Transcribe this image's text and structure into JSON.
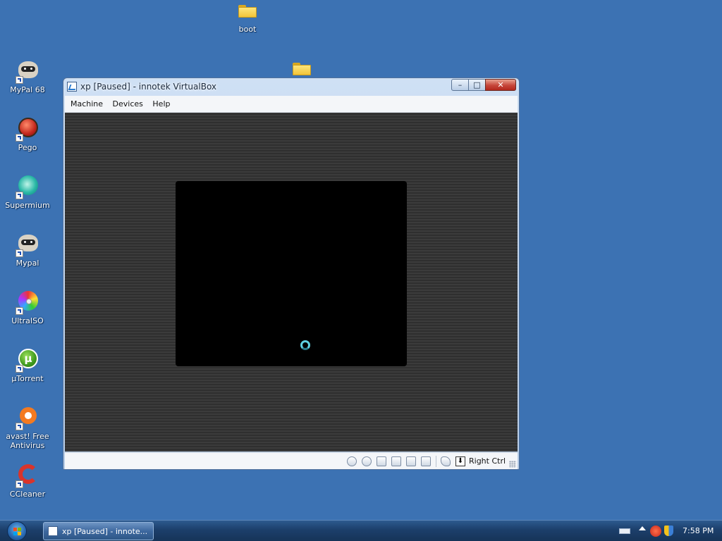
{
  "desktop": {
    "icons": [
      {
        "label": "MyPal 68",
        "icon": "raccoon-icon"
      },
      {
        "label": "Pego",
        "icon": "red-ball-icon"
      },
      {
        "label": "Supermium",
        "icon": "supermium-icon"
      },
      {
        "label": "Mypal",
        "icon": "raccoon-icon"
      },
      {
        "label": "UltraISO",
        "icon": "disc-icon"
      },
      {
        "label": "µTorrent",
        "icon": "utorrent-icon"
      },
      {
        "label": "avast! Free Antivirus",
        "icon": "avast-icon"
      },
      {
        "label": "CCleaner",
        "icon": "ccleaner-icon"
      }
    ],
    "folders": [
      {
        "label": "boot"
      },
      {
        "label": ""
      }
    ]
  },
  "window": {
    "title": "xp [Paused] - innotek VirtualBox",
    "buttons": {
      "minimize": "–",
      "maximize": "□",
      "close": "✕"
    },
    "menu": [
      "Machine",
      "Devices",
      "Help"
    ],
    "statusbar": {
      "icons": [
        "hard-disk-icon",
        "cd-icon",
        "floppy-icon",
        "network-icon",
        "usb-icon",
        "shared-folder-icon",
        "mouse-integration-icon",
        "host-key-icon"
      ],
      "host_key_glyph": "⬇",
      "host_key": "Right Ctrl"
    }
  },
  "taskbar": {
    "task_label": "xp [Paused] - innote...",
    "clock": "7:58 PM"
  },
  "colors": {
    "desktop": "#3c72b3",
    "vm_background": "#3a3a3a",
    "spinner": "#5fd0e0"
  }
}
